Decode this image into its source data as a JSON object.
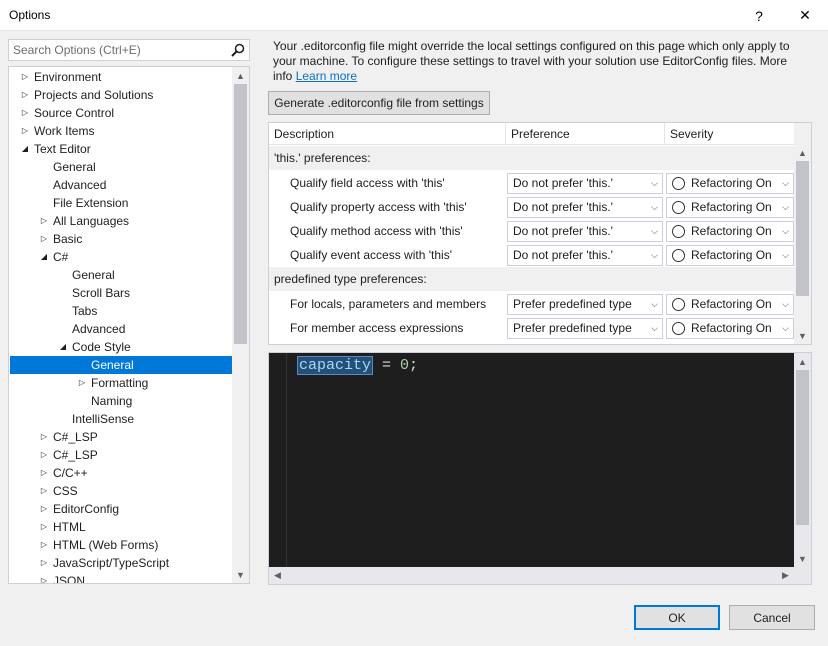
{
  "window": {
    "title": "Options",
    "help_glyph": "?",
    "close_glyph": "✕"
  },
  "search": {
    "placeholder": "Search Options (Ctrl+E)"
  },
  "tree": {
    "nodes": [
      {
        "label": "Environment",
        "level": 0,
        "arrow": "collapsed"
      },
      {
        "label": "Projects and Solutions",
        "level": 0,
        "arrow": "collapsed"
      },
      {
        "label": "Source Control",
        "level": 0,
        "arrow": "collapsed"
      },
      {
        "label": "Work Items",
        "level": 0,
        "arrow": "collapsed"
      },
      {
        "label": "Text Editor",
        "level": 0,
        "arrow": "expanded"
      },
      {
        "label": "General",
        "level": 1,
        "arrow": "none"
      },
      {
        "label": "Advanced",
        "level": 1,
        "arrow": "none"
      },
      {
        "label": "File Extension",
        "level": 1,
        "arrow": "none"
      },
      {
        "label": "All Languages",
        "level": 1,
        "arrow": "collapsed"
      },
      {
        "label": "Basic",
        "level": 1,
        "arrow": "collapsed"
      },
      {
        "label": "C#",
        "level": 1,
        "arrow": "expanded"
      },
      {
        "label": "General",
        "level": 2,
        "arrow": "none"
      },
      {
        "label": "Scroll Bars",
        "level": 2,
        "arrow": "none"
      },
      {
        "label": "Tabs",
        "level": 2,
        "arrow": "none"
      },
      {
        "label": "Advanced",
        "level": 2,
        "arrow": "none"
      },
      {
        "label": "Code Style",
        "level": 2,
        "arrow": "expanded"
      },
      {
        "label": "General",
        "level": 3,
        "arrow": "none",
        "selected": true
      },
      {
        "label": "Formatting",
        "level": 3,
        "arrow": "collapsed"
      },
      {
        "label": "Naming",
        "level": 3,
        "arrow": "none"
      },
      {
        "label": "IntelliSense",
        "level": 2,
        "arrow": "none"
      },
      {
        "label": "C#_LSP",
        "level": 1,
        "arrow": "collapsed"
      },
      {
        "label": "C#_LSP",
        "level": 1,
        "arrow": "collapsed"
      },
      {
        "label": "C/C++",
        "level": 1,
        "arrow": "collapsed"
      },
      {
        "label": "CSS",
        "level": 1,
        "arrow": "collapsed"
      },
      {
        "label": "EditorConfig",
        "level": 1,
        "arrow": "collapsed"
      },
      {
        "label": "HTML",
        "level": 1,
        "arrow": "collapsed"
      },
      {
        "label": "HTML (Web Forms)",
        "level": 1,
        "arrow": "collapsed"
      },
      {
        "label": "JavaScript/TypeScript",
        "level": 1,
        "arrow": "collapsed"
      },
      {
        "label": "JSON",
        "level": 1,
        "arrow": "collapsed"
      }
    ]
  },
  "notice": {
    "text": "Your .editorconfig file might override the local settings configured on this page which only apply to your machine. To configure these settings to travel with your solution use EditorConfig files. More info",
    "link": "Learn more"
  },
  "generate_button": "Generate .editorconfig file from settings",
  "grid": {
    "headers": [
      "Description",
      "Preference",
      "Severity"
    ],
    "rows": [
      {
        "type": "group",
        "label": "'this.' preferences:"
      },
      {
        "type": "item",
        "label": "Qualify field access with 'this'",
        "preference": "Do not prefer 'this.'",
        "severity": "Refactoring On"
      },
      {
        "type": "item",
        "label": "Qualify property access with 'this'",
        "preference": "Do not prefer 'this.'",
        "severity": "Refactoring On"
      },
      {
        "type": "item",
        "label": "Qualify method access with 'this'",
        "preference": "Do not prefer 'this.'",
        "severity": "Refactoring On"
      },
      {
        "type": "item",
        "label": "Qualify event access with 'this'",
        "preference": "Do not prefer 'this.'",
        "severity": "Refactoring On"
      },
      {
        "type": "group",
        "label": "predefined type preferences:"
      },
      {
        "type": "item",
        "label": "For locals, parameters and members",
        "preference": "Prefer predefined type",
        "severity": "Refactoring On"
      },
      {
        "type": "item",
        "label": "For member access expressions",
        "preference": "Prefer predefined type",
        "severity": "Refactoring On"
      }
    ]
  },
  "editor": {
    "identifier": "capacity",
    "rest_before_num": " = ",
    "number": "0",
    "terminator": ";"
  },
  "buttons": {
    "ok": "OK",
    "cancel": "Cancel"
  },
  "colors": {
    "selection": "#0078d7",
    "editor_bg": "#1e1e1e",
    "link": "#0e70c0"
  }
}
